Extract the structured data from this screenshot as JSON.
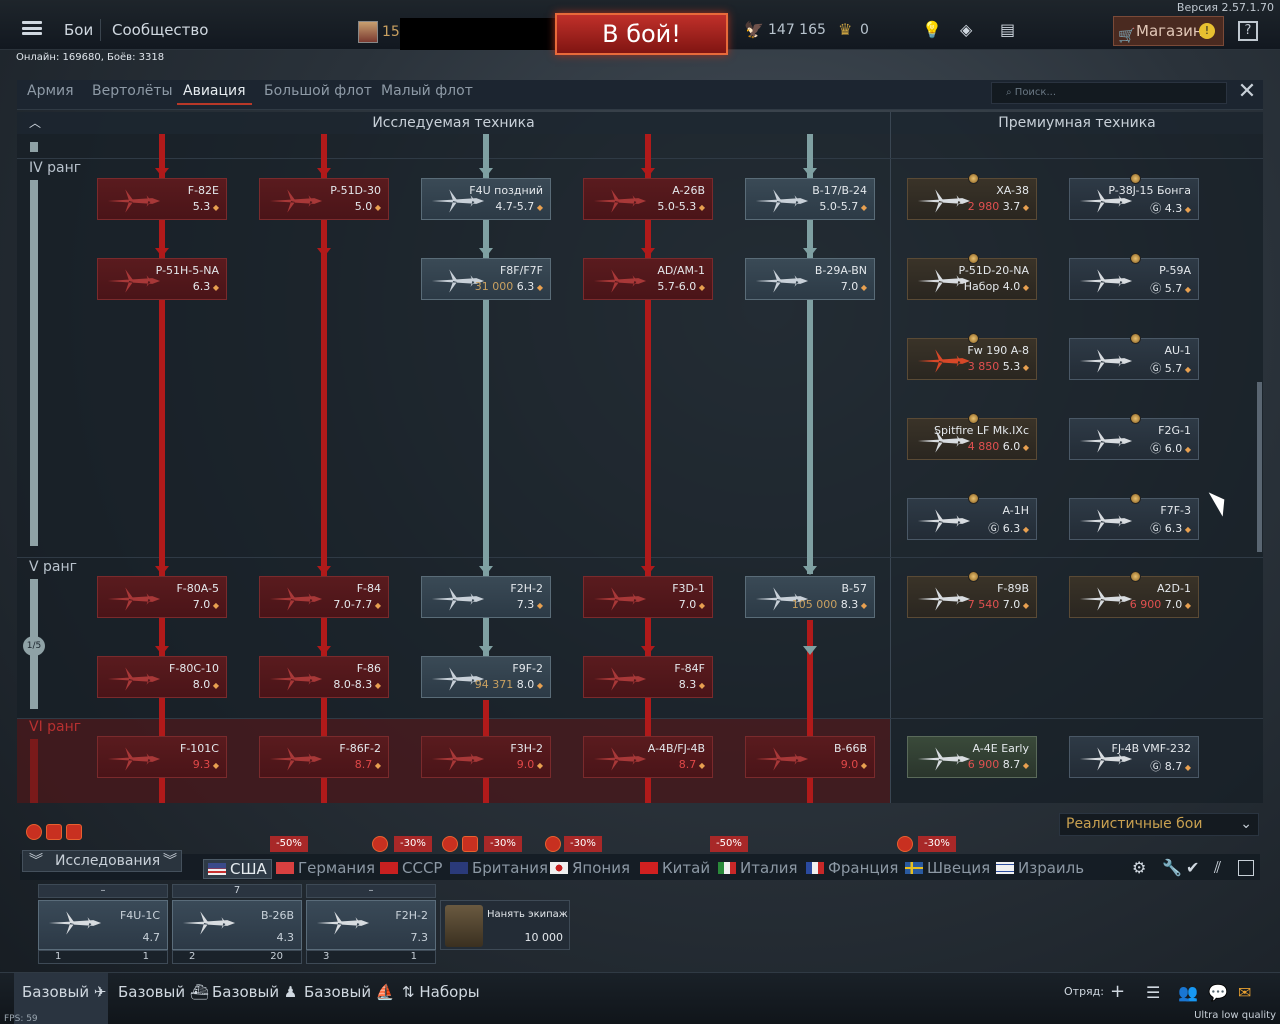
{
  "version": "Версия 2.57.1.70",
  "nav": {
    "battles": "Бои",
    "community": "Сообщество"
  },
  "profile": {
    "name": "15"
  },
  "battle_button": "В бой!",
  "currency": {
    "silver": "147 165",
    "gold": "0"
  },
  "shop": "Магазин",
  "help": "?",
  "online": "Онлайн: 169680, Боёв: 3318",
  "tabs": [
    {
      "label": "Армия"
    },
    {
      "label": "Вертолёты"
    },
    {
      "label": "Авиация"
    },
    {
      "label": "Большой флот"
    },
    {
      "label": "Малый флот"
    }
  ],
  "search_placeholder": "Поиск...",
  "headers": {
    "research": "Исследуемая техника",
    "premium": "Премиумная техника"
  },
  "ranks": {
    "iv": "IV ранг",
    "v": "V ранг",
    "vi": "VI ранг",
    "progress": "1/5"
  },
  "cards": [
    {
      "name": "F-82E",
      "br": "5.3",
      "kind": "red"
    },
    {
      "name": "P-51D-30",
      "br": "5.0",
      "kind": "red"
    },
    {
      "name": "F4U поздний",
      "br": "4.7-5.7",
      "kind": "teal"
    },
    {
      "name": "A-26B",
      "br": "5.0-5.3",
      "kind": "red"
    },
    {
      "name": "B-17/B-24",
      "br": "5.0-5.7",
      "kind": "teal"
    },
    {
      "name": "P-51H-5-NA",
      "br": "6.3",
      "kind": "red"
    },
    {
      "name": "F8F/F7F",
      "br": "6.3",
      "price": "31 000",
      "kind": "teal"
    },
    {
      "name": "AD/AM-1",
      "br": "5.7-6.0",
      "kind": "red"
    },
    {
      "name": "B-29A-BN",
      "br": "7.0",
      "kind": "teal"
    },
    {
      "name": "F-80A-5",
      "br": "7.0",
      "kind": "red"
    },
    {
      "name": "F-84",
      "br": "7.0-7.7",
      "kind": "red"
    },
    {
      "name": "F2H-2",
      "br": "7.3",
      "kind": "teal"
    },
    {
      "name": "F3D-1",
      "br": "7.0",
      "kind": "red"
    },
    {
      "name": "B-57",
      "br": "8.3",
      "price": "105 000",
      "kind": "teal"
    },
    {
      "name": "F-80C-10",
      "br": "8.0",
      "kind": "red"
    },
    {
      "name": "F-86",
      "br": "8.0-8.3",
      "kind": "red"
    },
    {
      "name": "F9F-2",
      "br": "8.0",
      "price": "94 371",
      "kind": "teal"
    },
    {
      "name": "F-84F",
      "br": "8.3",
      "kind": "red"
    },
    {
      "name": "F-101C",
      "br": "9.3",
      "kind": "red"
    },
    {
      "name": "F-86F-2",
      "br": "8.7",
      "kind": "red"
    },
    {
      "name": "F3H-2",
      "br": "9.0",
      "kind": "red"
    },
    {
      "name": "A-4B/FJ-4B",
      "br": "8.7",
      "kind": "red"
    },
    {
      "name": "B-66B",
      "br": "9.0",
      "kind": "red"
    }
  ],
  "premium": [
    {
      "name": "XA-38",
      "br": "3.7",
      "price": "2 980"
    },
    {
      "name": "P-38J-15 Бонга",
      "br": "4.3"
    },
    {
      "name": "P-51D-20-NA",
      "br": "4.0",
      "price": "Набор"
    },
    {
      "name": "P-59A",
      "br": "5.7"
    },
    {
      "name": "Fw 190 A-8",
      "br": "5.3",
      "price": "3 850"
    },
    {
      "name": "AU-1",
      "br": "5.7"
    },
    {
      "name": "Spitfire LF Mk.IXc",
      "br": "6.0",
      "price": "4 880"
    },
    {
      "name": "F2G-1",
      "br": "6.0"
    },
    {
      "name": "A-1H",
      "br": "6.3"
    },
    {
      "name": "F7F-3",
      "br": "6.3"
    },
    {
      "name": "F-89B",
      "br": "7.0",
      "price": "7 540"
    },
    {
      "name": "A2D-1",
      "br": "7.0",
      "price": "6 900"
    },
    {
      "name": "A-4E Early",
      "br": "8.7",
      "price": "6 900"
    },
    {
      "name": "FJ-4B VMF-232",
      "br": "8.7"
    }
  ],
  "mode": "Реалистичные бои",
  "research_label": "Исследования",
  "discounts": [
    "-50%",
    "-30%",
    "-30%",
    "-30%",
    "-50%",
    "-30%"
  ],
  "nations": [
    "США",
    "Германия",
    "СССР",
    "Британия",
    "Япония",
    "Китай",
    "Италия",
    "Франция",
    "Швеция",
    "Израиль"
  ],
  "crew": [
    {
      "head": "–",
      "name": "F4U-1C",
      "br": "4.7",
      "num": "1",
      "count": "1"
    },
    {
      "head": "7",
      "name": "B-26B",
      "br": "4.3",
      "num": "2",
      "count": "20"
    },
    {
      "head": "–",
      "name": "F2H-2",
      "br": "7.3",
      "num": "3",
      "count": "1"
    }
  ],
  "hire": {
    "label": "Нанять экипаж",
    "price": "10 000"
  },
  "footer": {
    "presets": [
      "Базовый",
      "Базовый",
      "Базовый",
      "Базовый"
    ],
    "sets": "Наборы",
    "squad": "Отряд:"
  },
  "fps": "FPS: 59",
  "quality": "Ultra low quality"
}
